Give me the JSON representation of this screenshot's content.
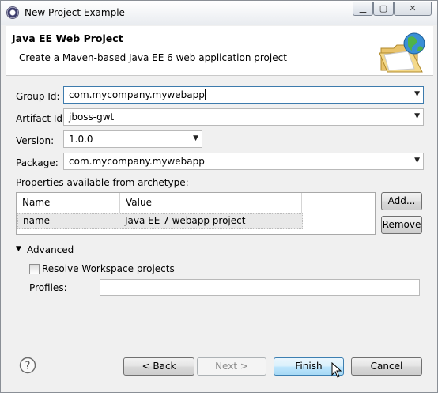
{
  "window": {
    "title": "New Project Example"
  },
  "title_buttons": {
    "minimize": "▁",
    "maximize": "▢",
    "close": "✕"
  },
  "banner": {
    "title": "Java EE Web Project",
    "description": "Create a Maven-based Java EE 6 web application project"
  },
  "form": {
    "group_id": {
      "label": "Group Id:",
      "value": "com.mycompany.mywebapp"
    },
    "artifact_id": {
      "label": "Artifact Id:",
      "value": "jboss-gwt"
    },
    "version": {
      "label": "Version:",
      "value": "1.0.0"
    },
    "package": {
      "label": "Package:",
      "value": "com.mycompany.mywebapp"
    }
  },
  "properties": {
    "label": "Properties available from archetype:",
    "columns": [
      "Name",
      "Value"
    ],
    "rows": [
      {
        "name": "name",
        "value": "Java EE 7 webapp project"
      }
    ],
    "add_button": "Add...",
    "remove_button": "Remove"
  },
  "advanced": {
    "label": "Advanced",
    "expanded": true,
    "resolve_workspace_label": "Resolve Workspace projects",
    "resolve_workspace_checked": false,
    "profiles_label": "Profiles:",
    "profiles_value": ""
  },
  "footer": {
    "help_icon": "question-mark",
    "back": "< Back",
    "next": "Next >",
    "finish": "Finish",
    "cancel": "Cancel"
  },
  "colors": {
    "focus_border": "#3d7bad",
    "default_button": "#a7d9f5"
  }
}
